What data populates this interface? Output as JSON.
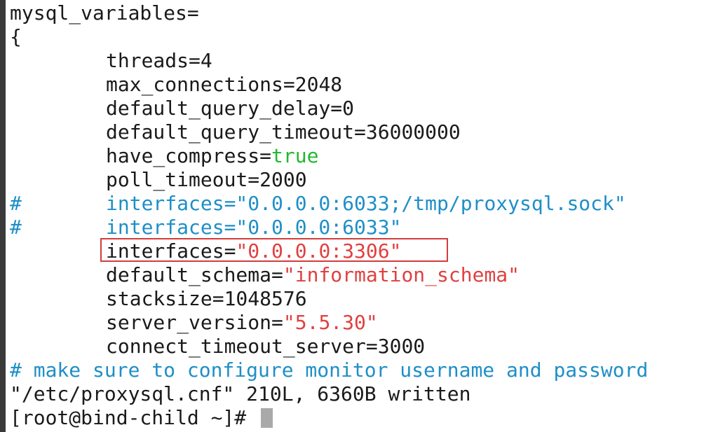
{
  "terminal": {
    "lines": [
      {
        "type": "plain",
        "text": "mysql_variables="
      },
      {
        "type": "plain",
        "text": "{"
      },
      {
        "type": "kv",
        "key": "threads",
        "eq": "=",
        "value": "4",
        "vtype": "plain"
      },
      {
        "type": "kv",
        "key": "max_connections",
        "eq": "=",
        "value": "2048",
        "vtype": "plain"
      },
      {
        "type": "kv",
        "key": "default_query_delay",
        "eq": "=",
        "value": "0",
        "vtype": "plain"
      },
      {
        "type": "kv",
        "key": "default_query_timeout",
        "eq": "=",
        "value": "36000000",
        "vtype": "plain"
      },
      {
        "type": "kv",
        "key": "have_compress",
        "eq": "=",
        "value": "true",
        "vtype": "bool"
      },
      {
        "type": "kv",
        "key": "poll_timeout",
        "eq": "=",
        "value": "2000",
        "vtype": "plain"
      },
      {
        "type": "commented",
        "hash": "#",
        "text": "interfaces=\"0.0.0.0:6033;/tmp/proxysql.sock\""
      },
      {
        "type": "commented",
        "hash": "#",
        "text": "interfaces=\"0.0.0.0:6033\""
      },
      {
        "type": "kv",
        "key": "interfaces",
        "eq": "=",
        "value": "\"0.0.0.0:3306\"",
        "vtype": "string",
        "highlighted": true
      },
      {
        "type": "kv",
        "key": "default_schema",
        "eq": "=",
        "value": "\"information_schema\"",
        "vtype": "string"
      },
      {
        "type": "kv",
        "key": "stacksize",
        "eq": "=",
        "value": "1048576",
        "vtype": "plain"
      },
      {
        "type": "kv",
        "key": "server_version",
        "eq": "=",
        "value": "\"5.5.30\"",
        "vtype": "string"
      },
      {
        "type": "kv",
        "key": "connect_timeout_server",
        "eq": "=",
        "value": "3000",
        "vtype": "plain"
      },
      {
        "type": "comment",
        "text": "# make sure to configure monitor username and password"
      },
      {
        "type": "plain",
        "text": "\"/etc/proxysql.cnf\" 210L, 6360B written"
      },
      {
        "type": "prompt",
        "text": "[root@bind-child ~]# "
      }
    ]
  },
  "colors": {
    "comment": "#1e8fc7",
    "string": "#e04040",
    "bool": "#22b830",
    "text": "#1a1a1a",
    "highlight_border": "#d43c3c"
  }
}
